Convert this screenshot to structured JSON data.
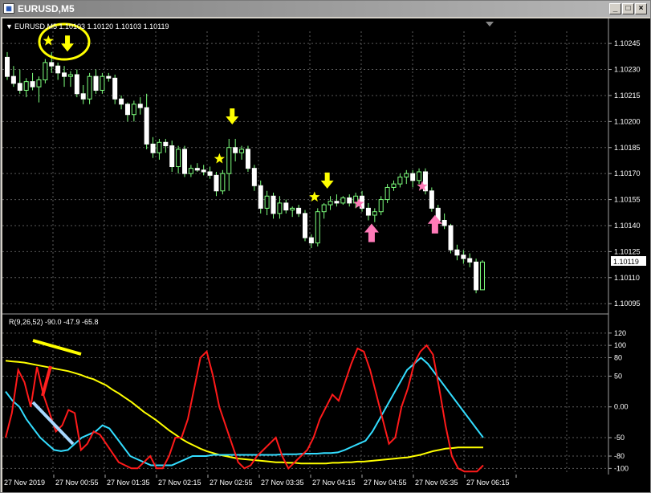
{
  "window": {
    "title": "EURUSD,M5",
    "buttons": [
      "minimize",
      "maximize",
      "close"
    ]
  },
  "main_header": "EURUSD,M5  1.10103 1.10120 1.10103 1.10119",
  "price_axis": [
    "1.10245",
    "1.10230",
    "1.10215",
    "1.10200",
    "1.10185",
    "1.10170",
    "1.10155",
    "1.10140",
    "1.10125",
    "1.10110",
    "1.10095"
  ],
  "current_price": "1.10119",
  "indicator_header": "R(9,26,52) -90.0 -47.9 -65.8",
  "indicator_axis": [
    "120",
    "100",
    "80",
    "50",
    "0.00",
    "-50",
    "-80",
    "-100"
  ],
  "time_axis": [
    "27 Nov 2019",
    "27 Nov 00:55",
    "27 Nov 01:35",
    "27 Nov 02:15",
    "27 Nov 02:55",
    "27 Nov 03:35",
    "27 Nov 04:15",
    "27 Nov 04:55",
    "27 Nov 05:35",
    "27 Nov 06:15"
  ],
  "colors": {
    "bull": "#000000",
    "bull_outline": "#7dff7d",
    "bear": "#ffffff",
    "grid": "#5a5a5a",
    "red": "#ff1a1a",
    "yellow": "#ffff00",
    "cyan": "#33ddff",
    "pink": "#ff7ab8"
  },
  "chart_data": {
    "type": "candlestick",
    "price_range": [
      1.1009,
      1.10252
    ],
    "candles": [
      [
        1.10237,
        1.1024,
        1.10224,
        1.10226
      ],
      [
        1.10226,
        1.10232,
        1.1022,
        1.10222
      ],
      [
        1.10222,
        1.1023,
        1.10216,
        1.10218
      ],
      [
        1.10218,
        1.10225,
        1.10214,
        1.10223
      ],
      [
        1.10223,
        1.10228,
        1.10218,
        1.1022
      ],
      [
        1.1022,
        1.10226,
        1.10211,
        1.10224
      ],
      [
        1.10224,
        1.10236,
        1.10222,
        1.10234
      ],
      [
        1.10234,
        1.1024,
        1.10228,
        1.10232
      ],
      [
        1.10232,
        1.10234,
        1.10224,
        1.10228
      ],
      [
        1.10228,
        1.10232,
        1.1022,
        1.10226
      ],
      [
        1.10226,
        1.10229,
        1.1022,
        1.10227
      ],
      [
        1.10227,
        1.1023,
        1.10214,
        1.10216
      ],
      [
        1.10216,
        1.10221,
        1.1021,
        1.10213
      ],
      [
        1.10213,
        1.10228,
        1.1021,
        1.10226
      ],
      [
        1.10226,
        1.1023,
        1.10216,
        1.10218
      ],
      [
        1.10218,
        1.10228,
        1.10216,
        1.10226
      ],
      [
        1.10226,
        1.10228,
        1.10223,
        1.10225
      ],
      [
        1.10225,
        1.10227,
        1.1021,
        1.10213
      ],
      [
        1.10213,
        1.10215,
        1.10207,
        1.1021
      ],
      [
        1.1021,
        1.10211,
        1.102,
        1.10204
      ],
      [
        1.10204,
        1.10212,
        1.102,
        1.1021
      ],
      [
        1.1021,
        1.10214,
        1.10204,
        1.10208
      ],
      [
        1.10208,
        1.10216,
        1.10184,
        1.10187
      ],
      [
        1.10187,
        1.10191,
        1.10179,
        1.10182
      ],
      [
        1.10182,
        1.1019,
        1.10178,
        1.10188
      ],
      [
        1.10188,
        1.1019,
        1.10182,
        1.10186
      ],
      [
        1.10186,
        1.10189,
        1.10171,
        1.10174
      ],
      [
        1.10174,
        1.10186,
        1.1017,
        1.10184
      ],
      [
        1.10184,
        1.10186,
        1.10168,
        1.1017
      ],
      [
        1.1017,
        1.10175,
        1.10168,
        1.10173
      ],
      [
        1.10173,
        1.10176,
        1.10171,
        1.10172
      ],
      [
        1.10172,
        1.10175,
        1.10169,
        1.10171
      ],
      [
        1.10171,
        1.10174,
        1.10167,
        1.10169
      ],
      [
        1.10169,
        1.10171,
        1.10157,
        1.1016
      ],
      [
        1.1016,
        1.10172,
        1.10158,
        1.1017
      ],
      [
        1.1017,
        1.1019,
        1.1016,
        1.10185
      ],
      [
        1.10185,
        1.1019,
        1.10177,
        1.10182
      ],
      [
        1.10182,
        1.10186,
        1.10178,
        1.10184
      ],
      [
        1.10184,
        1.10186,
        1.10171,
        1.10173
      ],
      [
        1.10173,
        1.10175,
        1.1016,
        1.10163
      ],
      [
        1.10163,
        1.10166,
        1.10147,
        1.1015
      ],
      [
        1.1015,
        1.1016,
        1.10146,
        1.10157
      ],
      [
        1.10157,
        1.10159,
        1.10144,
        1.10147
      ],
      [
        1.10147,
        1.10157,
        1.10144,
        1.10153
      ],
      [
        1.10153,
        1.10155,
        1.10147,
        1.10149
      ],
      [
        1.10149,
        1.10151,
        1.10145,
        1.1015
      ],
      [
        1.1015,
        1.10152,
        1.10145,
        1.10147
      ],
      [
        1.10147,
        1.10149,
        1.10131,
        1.10133
      ],
      [
        1.10133,
        1.10135,
        1.10127,
        1.1013
      ],
      [
        1.1013,
        1.1015,
        1.10128,
        1.10148
      ],
      [
        1.10148,
        1.10153,
        1.10144,
        1.10152
      ],
      [
        1.10152,
        1.10157,
        1.10149,
        1.10154
      ],
      [
        1.10154,
        1.10158,
        1.10151,
        1.10153
      ],
      [
        1.10153,
        1.10157,
        1.10152,
        1.10156
      ],
      [
        1.10156,
        1.10158,
        1.10151,
        1.10153
      ],
      [
        1.10153,
        1.10159,
        1.1015,
        1.10157
      ],
      [
        1.10157,
        1.1016,
        1.10148,
        1.1015
      ],
      [
        1.1015,
        1.10153,
        1.10143,
        1.10146
      ],
      [
        1.10146,
        1.1015,
        1.10142,
        1.10148
      ],
      [
        1.10148,
        1.10157,
        1.10146,
        1.10155
      ],
      [
        1.10155,
        1.10164,
        1.10153,
        1.10162
      ],
      [
        1.10162,
        1.10166,
        1.1016,
        1.10164
      ],
      [
        1.10164,
        1.1017,
        1.10162,
        1.10168
      ],
      [
        1.10168,
        1.10172,
        1.10164,
        1.1017
      ],
      [
        1.1017,
        1.10172,
        1.10162,
        1.10166
      ],
      [
        1.10166,
        1.10173,
        1.10164,
        1.10171
      ],
      [
        1.10171,
        1.10173,
        1.10158,
        1.1016
      ],
      [
        1.1016,
        1.10162,
        1.10148,
        1.1015
      ],
      [
        1.1015,
        1.10152,
        1.10141,
        1.10143
      ],
      [
        1.10143,
        1.10147,
        1.10138,
        1.1014
      ],
      [
        1.1014,
        1.10141,
        1.10124,
        1.10126
      ],
      [
        1.10126,
        1.10129,
        1.1012,
        1.10123
      ],
      [
        1.10123,
        1.10126,
        1.10118,
        1.10121
      ],
      [
        1.10121,
        1.10124,
        1.10116,
        1.10119
      ],
      [
        1.10119,
        1.10121,
        1.10101,
        1.10103
      ],
      [
        1.10103,
        1.1012,
        1.10103,
        1.10119
      ]
    ],
    "indicator": {
      "range": [
        -110,
        125
      ],
      "red": [
        -50,
        -10,
        60,
        40,
        0,
        65,
        20,
        -10,
        -40,
        -30,
        -5,
        -10,
        -70,
        -60,
        -40,
        -45,
        -60,
        -75,
        -90,
        -95,
        -100,
        -100,
        -90,
        -80,
        -100,
        -100,
        -80,
        -50,
        -50,
        -20,
        30,
        80,
        90,
        50,
        0,
        -30,
        -60,
        -90,
        -100,
        -95,
        -80,
        -70,
        -60,
        -50,
        -80,
        -100,
        -90,
        -80,
        -70,
        -50,
        -20,
        0,
        20,
        10,
        40,
        70,
        95,
        90,
        60,
        20,
        -20,
        -60,
        -50,
        0,
        30,
        70,
        90,
        100,
        85,
        30,
        -30,
        -80,
        -100,
        -105,
        -105,
        -105,
        -95
      ],
      "yellow": [
        75,
        74,
        73,
        72,
        70,
        68,
        66,
        64,
        62,
        60,
        58,
        55,
        52,
        48,
        45,
        40,
        35,
        28,
        22,
        15,
        8,
        0,
        -8,
        -15,
        -22,
        -30,
        -38,
        -45,
        -52,
        -58,
        -63,
        -68,
        -72,
        -75,
        -78,
        -80,
        -82,
        -84,
        -85,
        -86,
        -87,
        -88,
        -89,
        -90,
        -90,
        -91,
        -91,
        -92,
        -92,
        -92,
        -92,
        -92,
        -91,
        -91,
        -90,
        -90,
        -89,
        -89,
        -88,
        -87,
        -86,
        -85,
        -84,
        -83,
        -82,
        -80,
        -78,
        -75,
        -72,
        -70,
        -68,
        -67,
        -66,
        -66,
        -66,
        -66,
        -66
      ],
      "cyan": [
        25,
        10,
        0,
        -20,
        -35,
        -50,
        -60,
        -70,
        -72,
        -70,
        -60,
        -50,
        -45,
        -40,
        -30,
        -35,
        -50,
        -65,
        -80,
        -85,
        -90,
        -95,
        -95,
        -95,
        -95,
        -90,
        -85,
        -80,
        -80,
        -80,
        -78,
        -78,
        -78,
        -78,
        -78,
        -78,
        -78,
        -78,
        -78,
        -78,
        -77,
        -77,
        -77,
        -76,
        -76,
        -76,
        -75,
        -75,
        -74,
        -70,
        -65,
        -60,
        -55,
        -40,
        -20,
        0,
        20,
        40,
        60,
        70,
        80,
        70,
        55,
        40,
        25,
        10,
        -5,
        -20,
        -35,
        -50
      ]
    },
    "markers": [
      {
        "type": "arrow-down",
        "color": "yellow",
        "candle": 9
      },
      {
        "type": "star",
        "color": "yellow",
        "candle": 7
      },
      {
        "type": "arrow-down",
        "color": "yellow",
        "candle": 35
      },
      {
        "type": "star",
        "color": "yellow",
        "candle": 34
      },
      {
        "type": "arrow-down",
        "color": "yellow",
        "candle": 50
      },
      {
        "type": "star",
        "color": "yellow",
        "candle": 49
      },
      {
        "type": "arrow-up",
        "color": "pink",
        "candle": 57
      },
      {
        "type": "star",
        "color": "pink",
        "candle": 56
      },
      {
        "type": "arrow-up",
        "color": "pink",
        "candle": 67
      },
      {
        "type": "star",
        "color": "pink",
        "candle": 66
      }
    ]
  }
}
